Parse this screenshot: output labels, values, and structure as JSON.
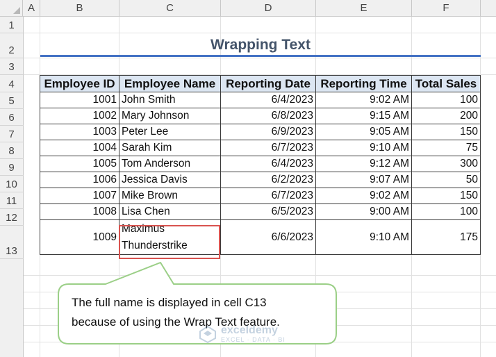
{
  "columns": [
    "A",
    "B",
    "C",
    "D",
    "E",
    "F"
  ],
  "rows": [
    "1",
    "2",
    "3",
    "4",
    "5",
    "6",
    "7",
    "8",
    "9",
    "10",
    "11",
    "12",
    "13"
  ],
  "title": "Wrapping Text",
  "table": {
    "headers": [
      "Employee ID",
      "Employee Name",
      "Reporting Date",
      "Reporting Time",
      "Total Sales"
    ],
    "rows": [
      [
        "1001",
        "John Smith",
        "6/4/2023",
        "9:02 AM",
        "100"
      ],
      [
        "1002",
        "Mary Johnson",
        "6/8/2023",
        "9:15 AM",
        "200"
      ],
      [
        "1003",
        "Peter Lee",
        "6/9/2023",
        "9:05 AM",
        "150"
      ],
      [
        "1004",
        "Sarah Kim",
        "6/7/2023",
        "9:10 AM",
        "75"
      ],
      [
        "1005",
        "Tom Anderson",
        "6/4/2023",
        "9:12 AM",
        "300"
      ],
      [
        "1006",
        "Jessica Davis",
        "6/2/2023",
        "9:07 AM",
        "50"
      ],
      [
        "1007",
        "Mike Brown",
        "6/7/2023",
        "9:02 AM",
        "150"
      ],
      [
        "1008",
        "Lisa Chen",
        "6/5/2023",
        "9:00 AM",
        "100"
      ],
      [
        "1009",
        "Maximus Thunderstrike",
        "6/6/2023",
        "9:10 AM",
        "175"
      ]
    ]
  },
  "callout": {
    "line1": "The full name is displayed in cell C13",
    "line2": "because of using the Wrap Text feature."
  },
  "watermark": {
    "name": "exceldemy",
    "tagline": "EXCEL · DATA · BI"
  },
  "colors": {
    "header_fill": "#dce6f2",
    "title_text": "#44546a",
    "title_rule": "#4472c4",
    "highlight_border": "#d9534f",
    "callout_border": "#9bcf87"
  }
}
